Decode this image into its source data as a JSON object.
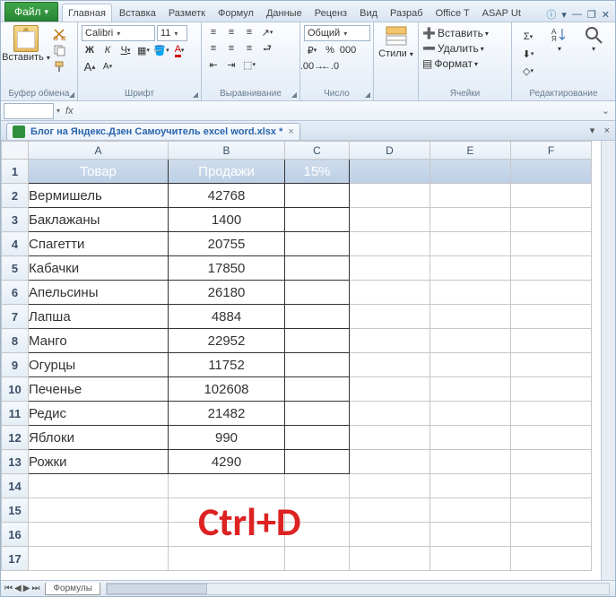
{
  "tabs": {
    "file": "Файл",
    "list": [
      "Главная",
      "Вставка",
      "Разметк",
      "Формул",
      "Данные",
      "Реценз",
      "Вид",
      "Разраб",
      "Office T",
      "ASAP Ut"
    ],
    "active_index": 0
  },
  "ribbon": {
    "clipboard": {
      "btn": "Вставить",
      "label": "Буфер обмена"
    },
    "font": {
      "face": "Calibri",
      "size": "11",
      "label": "Шрифт",
      "grow": "A",
      "shrink": "A"
    },
    "align": {
      "label": "Выравнивание",
      "wrap": "≡",
      "merge": "⧉"
    },
    "number": {
      "format": "Общий",
      "label": "Число"
    },
    "styles": {
      "btn": "Стили",
      "label": ""
    },
    "cells": {
      "insert": "Вставить",
      "delete": "Удалить",
      "format": "Формат",
      "label": "Ячейки"
    },
    "editing": {
      "sum": "Σ",
      "fill": "▾",
      "clear": "◇",
      "label": "Редактирование"
    }
  },
  "fx_bar": {
    "fx": "fx"
  },
  "doc_tab": {
    "name": "Блог на Яндекс.Дзен Самоучитель excel word.xlsx *"
  },
  "headers": {
    "A": "Товар",
    "B": "Продажи",
    "C": "15%"
  },
  "columns": [
    "A",
    "B",
    "C",
    "D",
    "E",
    "F"
  ],
  "rows": [
    {
      "a": "Вермишель",
      "b": "42768"
    },
    {
      "a": "Баклажаны",
      "b": "1400"
    },
    {
      "a": "Спагетти",
      "b": "20755"
    },
    {
      "a": "Кабачки",
      "b": "17850"
    },
    {
      "a": "Апельсины",
      "b": "26180"
    },
    {
      "a": "Лапша",
      "b": "4884"
    },
    {
      "a": "Манго",
      "b": "22952"
    },
    {
      "a": "Огурцы",
      "b": "11752"
    },
    {
      "a": "Печенье",
      "b": "102608"
    },
    {
      "a": "Редис",
      "b": "21482"
    },
    {
      "a": "Яблоки",
      "b": "990"
    },
    {
      "a": "Рожки",
      "b": "4290"
    }
  ],
  "overlay_text": "Ctrl+D",
  "sheet_tab": "Формулы",
  "chart_data": {
    "type": "table",
    "title": "",
    "columns": [
      "Товар",
      "Продажи",
      "15%"
    ],
    "data": [
      [
        "Вермишель",
        42768,
        null
      ],
      [
        "Баклажаны",
        1400,
        null
      ],
      [
        "Спагетти",
        20755,
        null
      ],
      [
        "Кабачки",
        17850,
        null
      ],
      [
        "Апельсины",
        26180,
        null
      ],
      [
        "Лапша",
        4884,
        null
      ],
      [
        "Манго",
        22952,
        null
      ],
      [
        "Огурцы",
        11752,
        null
      ],
      [
        "Печенье",
        102608,
        null
      ],
      [
        "Редис",
        21482,
        null
      ],
      [
        "Яблоки",
        990,
        null
      ],
      [
        "Рожки",
        4290,
        null
      ]
    ]
  }
}
